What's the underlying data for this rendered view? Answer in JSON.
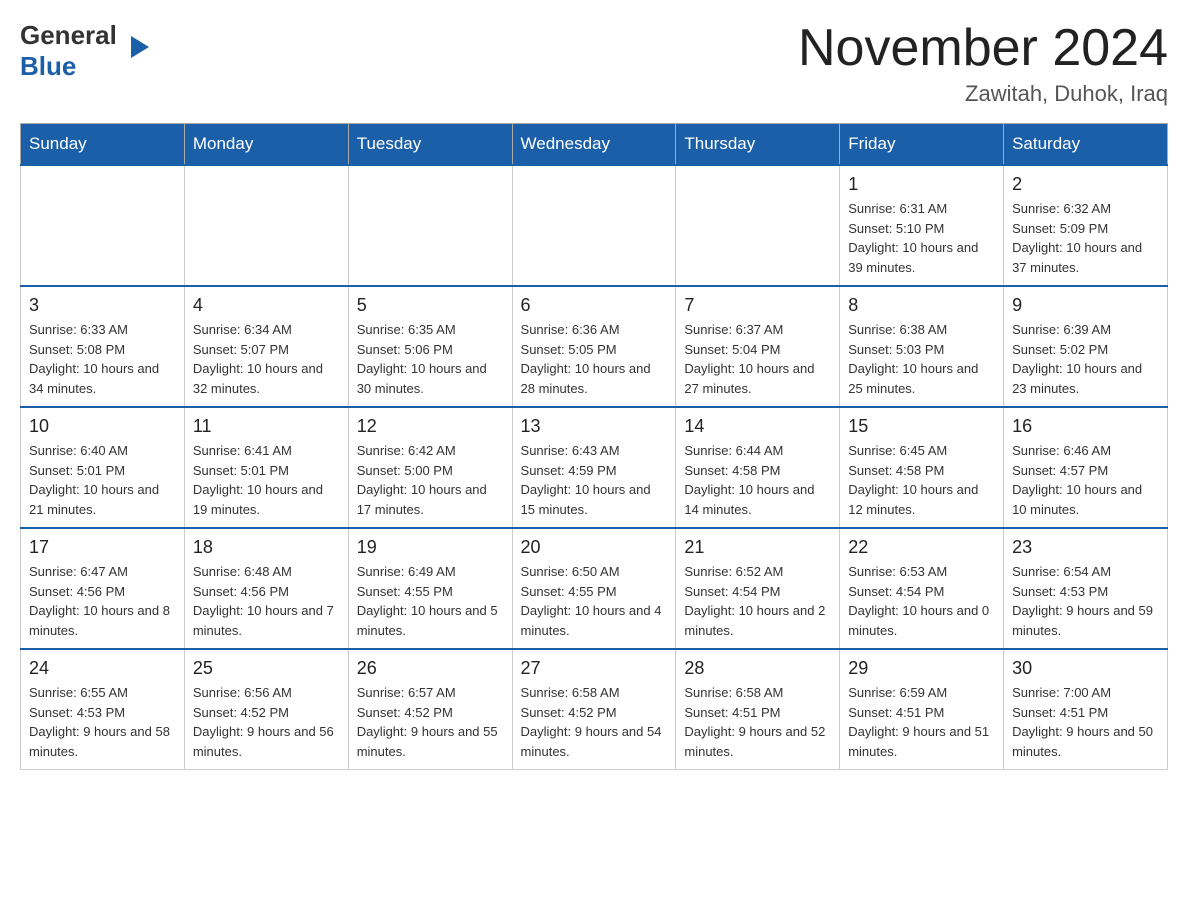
{
  "header": {
    "logo_general": "General",
    "logo_blue": "Blue",
    "month_title": "November 2024",
    "location": "Zawitah, Duhok, Iraq"
  },
  "days_of_week": [
    "Sunday",
    "Monday",
    "Tuesday",
    "Wednesday",
    "Thursday",
    "Friday",
    "Saturday"
  ],
  "weeks": [
    {
      "days": [
        {
          "num": "",
          "info": ""
        },
        {
          "num": "",
          "info": ""
        },
        {
          "num": "",
          "info": ""
        },
        {
          "num": "",
          "info": ""
        },
        {
          "num": "",
          "info": ""
        },
        {
          "num": "1",
          "info": "Sunrise: 6:31 AM\nSunset: 5:10 PM\nDaylight: 10 hours and 39 minutes."
        },
        {
          "num": "2",
          "info": "Sunrise: 6:32 AM\nSunset: 5:09 PM\nDaylight: 10 hours and 37 minutes."
        }
      ]
    },
    {
      "days": [
        {
          "num": "3",
          "info": "Sunrise: 6:33 AM\nSunset: 5:08 PM\nDaylight: 10 hours and 34 minutes."
        },
        {
          "num": "4",
          "info": "Sunrise: 6:34 AM\nSunset: 5:07 PM\nDaylight: 10 hours and 32 minutes."
        },
        {
          "num": "5",
          "info": "Sunrise: 6:35 AM\nSunset: 5:06 PM\nDaylight: 10 hours and 30 minutes."
        },
        {
          "num": "6",
          "info": "Sunrise: 6:36 AM\nSunset: 5:05 PM\nDaylight: 10 hours and 28 minutes."
        },
        {
          "num": "7",
          "info": "Sunrise: 6:37 AM\nSunset: 5:04 PM\nDaylight: 10 hours and 27 minutes."
        },
        {
          "num": "8",
          "info": "Sunrise: 6:38 AM\nSunset: 5:03 PM\nDaylight: 10 hours and 25 minutes."
        },
        {
          "num": "9",
          "info": "Sunrise: 6:39 AM\nSunset: 5:02 PM\nDaylight: 10 hours and 23 minutes."
        }
      ]
    },
    {
      "days": [
        {
          "num": "10",
          "info": "Sunrise: 6:40 AM\nSunset: 5:01 PM\nDaylight: 10 hours and 21 minutes."
        },
        {
          "num": "11",
          "info": "Sunrise: 6:41 AM\nSunset: 5:01 PM\nDaylight: 10 hours and 19 minutes."
        },
        {
          "num": "12",
          "info": "Sunrise: 6:42 AM\nSunset: 5:00 PM\nDaylight: 10 hours and 17 minutes."
        },
        {
          "num": "13",
          "info": "Sunrise: 6:43 AM\nSunset: 4:59 PM\nDaylight: 10 hours and 15 minutes."
        },
        {
          "num": "14",
          "info": "Sunrise: 6:44 AM\nSunset: 4:58 PM\nDaylight: 10 hours and 14 minutes."
        },
        {
          "num": "15",
          "info": "Sunrise: 6:45 AM\nSunset: 4:58 PM\nDaylight: 10 hours and 12 minutes."
        },
        {
          "num": "16",
          "info": "Sunrise: 6:46 AM\nSunset: 4:57 PM\nDaylight: 10 hours and 10 minutes."
        }
      ]
    },
    {
      "days": [
        {
          "num": "17",
          "info": "Sunrise: 6:47 AM\nSunset: 4:56 PM\nDaylight: 10 hours and 8 minutes."
        },
        {
          "num": "18",
          "info": "Sunrise: 6:48 AM\nSunset: 4:56 PM\nDaylight: 10 hours and 7 minutes."
        },
        {
          "num": "19",
          "info": "Sunrise: 6:49 AM\nSunset: 4:55 PM\nDaylight: 10 hours and 5 minutes."
        },
        {
          "num": "20",
          "info": "Sunrise: 6:50 AM\nSunset: 4:55 PM\nDaylight: 10 hours and 4 minutes."
        },
        {
          "num": "21",
          "info": "Sunrise: 6:52 AM\nSunset: 4:54 PM\nDaylight: 10 hours and 2 minutes."
        },
        {
          "num": "22",
          "info": "Sunrise: 6:53 AM\nSunset: 4:54 PM\nDaylight: 10 hours and 0 minutes."
        },
        {
          "num": "23",
          "info": "Sunrise: 6:54 AM\nSunset: 4:53 PM\nDaylight: 9 hours and 59 minutes."
        }
      ]
    },
    {
      "days": [
        {
          "num": "24",
          "info": "Sunrise: 6:55 AM\nSunset: 4:53 PM\nDaylight: 9 hours and 58 minutes."
        },
        {
          "num": "25",
          "info": "Sunrise: 6:56 AM\nSunset: 4:52 PM\nDaylight: 9 hours and 56 minutes."
        },
        {
          "num": "26",
          "info": "Sunrise: 6:57 AM\nSunset: 4:52 PM\nDaylight: 9 hours and 55 minutes."
        },
        {
          "num": "27",
          "info": "Sunrise: 6:58 AM\nSunset: 4:52 PM\nDaylight: 9 hours and 54 minutes."
        },
        {
          "num": "28",
          "info": "Sunrise: 6:58 AM\nSunset: 4:51 PM\nDaylight: 9 hours and 52 minutes."
        },
        {
          "num": "29",
          "info": "Sunrise: 6:59 AM\nSunset: 4:51 PM\nDaylight: 9 hours and 51 minutes."
        },
        {
          "num": "30",
          "info": "Sunrise: 7:00 AM\nSunset: 4:51 PM\nDaylight: 9 hours and 50 minutes."
        }
      ]
    }
  ]
}
